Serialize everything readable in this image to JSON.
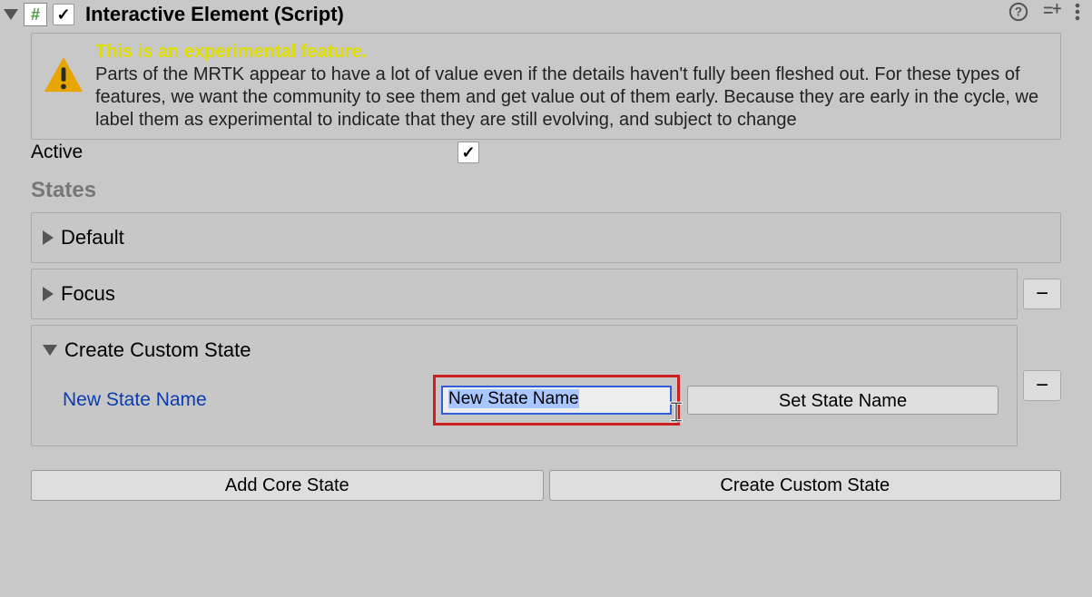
{
  "header": {
    "title": "Interactive Element (Script)",
    "enabled": true,
    "script_icon_char": "#"
  },
  "warning": {
    "title": "This is an experimental feature.",
    "body": "Parts of the MRTK appear to have a lot of value even if the details haven't fully been fleshed out. For these types of features, we want the community to see them and get value out of them early. Because they are early in the cycle, we label them as experimental to indicate that they are still evolving, and subject to change"
  },
  "active": {
    "label": "Active",
    "value": true
  },
  "sections": {
    "states_title": "States"
  },
  "states": [
    {
      "label": "Default",
      "expanded": false,
      "removable": false
    },
    {
      "label": "Focus",
      "expanded": false,
      "removable": true
    },
    {
      "label": "Create Custom State",
      "expanded": true,
      "removable": true
    }
  ],
  "custom_state": {
    "field_label": "New State Name",
    "input_value": "New State Name",
    "set_button": "Set State Name"
  },
  "buttons": {
    "add_core": "Add Core State",
    "create_custom": "Create Custom State"
  },
  "remove_glyph": "−"
}
